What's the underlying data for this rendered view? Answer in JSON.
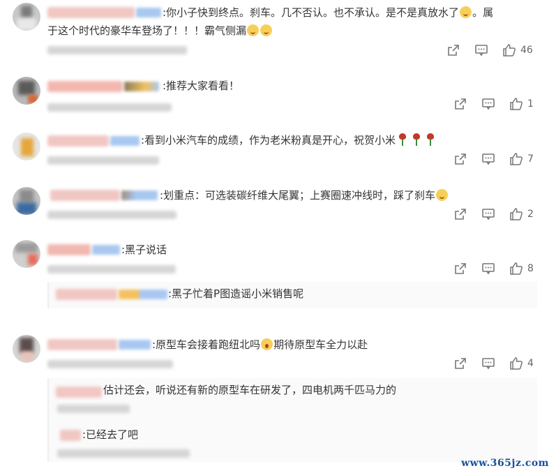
{
  "comments": [
    {
      "text_parts": [
        ":你小子快到终点。刹车。几不否认。也不承认。是不是真放水了",
        "。属",
        "于这个时代的豪华车登场了！！！霸气侧漏"
      ],
      "like_count": "46"
    },
    {
      "text": ":推荐大家看看！",
      "like_count": "1"
    },
    {
      "text": ":看到小米汽车的成绩，作为老米粉真是开心，祝贺小米",
      "like_count": "7"
    },
    {
      "text": ":划重点：可选装碳纤维大尾翼；上赛圈速冲线时，踩了刹车",
      "like_count": "2"
    },
    {
      "text": ":黑子说话",
      "like_count": "8",
      "reply": {
        "text": ":黑子忙着P图造谣小米销售呢"
      }
    },
    {
      "text_parts": [
        ":原型车会接着跑纽北吗",
        "期待原型车全力以赴"
      ],
      "like_count": "4",
      "replies": [
        {
          "text": "估计还会，听说还有新的原型车在研发了，四电机两千匹马力的"
        },
        {
          "text": ":已经去了吧"
        }
      ]
    }
  ],
  "icons": {
    "share": "share-icon",
    "comment": "comment-icon",
    "like": "thumbs-up-icon",
    "wink": "wink-emoji-icon",
    "rose": "rose-emoji-icon",
    "shock": "shocked-emoji-icon"
  },
  "colors": {
    "text": "#333333",
    "meta": "#777777",
    "watermark": "#1a4fa0",
    "blur_badge": "#a9c8f0"
  },
  "watermark": "www.365jz.com"
}
